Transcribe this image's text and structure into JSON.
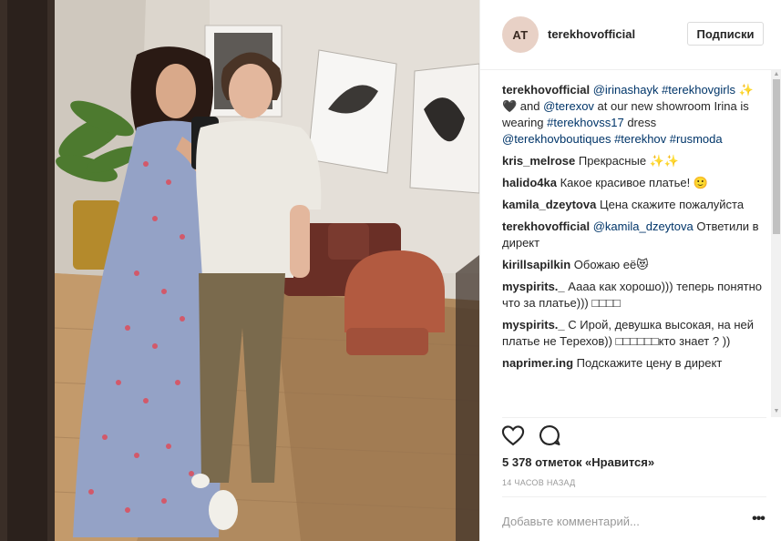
{
  "post": {
    "username": "terekhovofficial",
    "avatar_initials": "AT",
    "follow_label": "Подписки",
    "caption": {
      "user": "terekhovofficial",
      "mention1": "@irinashayk",
      "hashtag1": "#terekhovgirls",
      "emoji": "✨🖤",
      "and": " and ",
      "mention2": "@terexov",
      "text1": " at our new showroom Irina is wearing ",
      "hashtag2": "#terekhovss17",
      "text2": " dress ",
      "mention3": "@terekhovboutiques",
      "hashtag3": "#terekhov",
      "hashtag4": "#rusmoda"
    },
    "comments": [
      {
        "user": "kris_melrose",
        "text": "Прекрасные ✨✨"
      },
      {
        "user": "halido4ka",
        "text": "Какое красивое платье! 🙂"
      },
      {
        "user": "kamila_dzeytova",
        "text": "Цена скажите пожалуйста"
      },
      {
        "user": "terekhovofficial",
        "mention": "@kamila_dzeytova",
        "text": "Ответили в директ"
      },
      {
        "user": "kirillsapilkin",
        "text": "Обожаю её😻"
      },
      {
        "user": "myspirits._",
        "text": "Аааа как хорошо))) теперь понятно что за платье))) □□□□"
      },
      {
        "user": "myspirits._",
        "text": "С Ирой, девушка высокая, на ней платье не Терехов)) □□□□□□кто знает ? ))"
      },
      {
        "user": "naprimer.ing",
        "text": "Подскажите цену в директ"
      }
    ],
    "likes": "5 378 отметок «Нравится»",
    "time": "14 ЧАСОВ НАЗАД",
    "add_comment_placeholder": "Добавьте комментарий...",
    "more_label": "•••"
  },
  "colors": {
    "link": "#003569",
    "text": "#262626",
    "muted": "#999999",
    "border": "#efefef"
  }
}
